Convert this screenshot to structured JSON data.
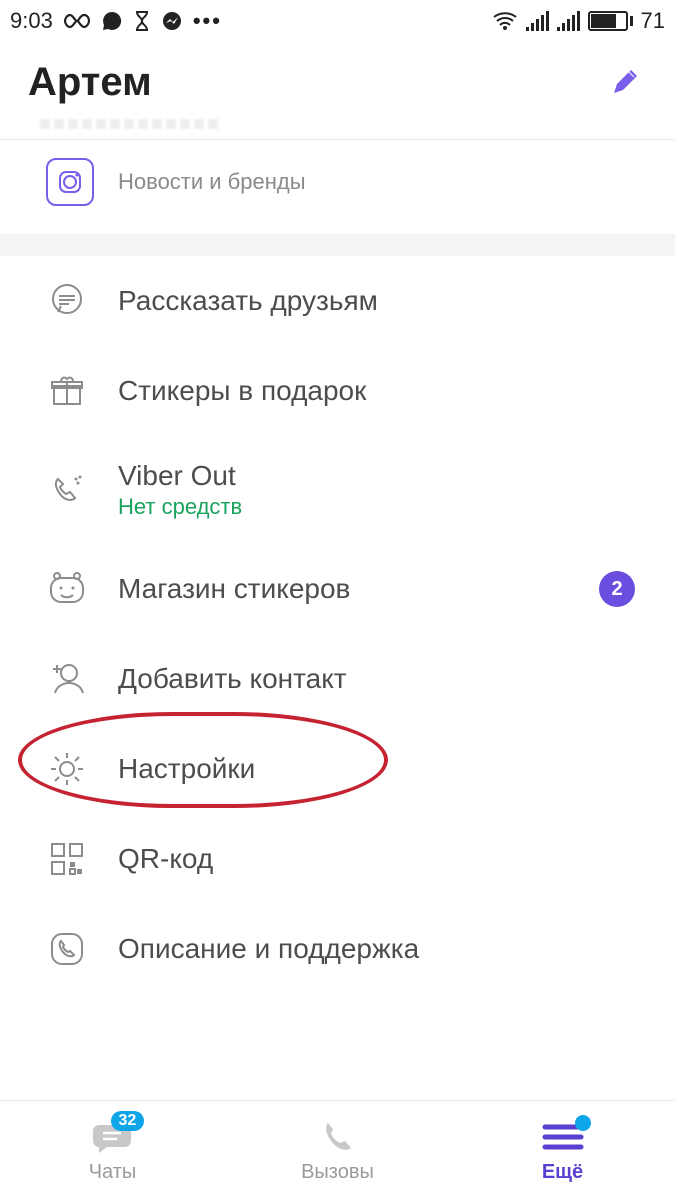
{
  "status": {
    "time": "9:03",
    "battery": "71"
  },
  "header": {
    "title": "Артем"
  },
  "news": {
    "subtitle": "Новости и бренды"
  },
  "menu": {
    "tell_friends": "Рассказать друзьям",
    "gift_stickers": "Стикеры в подарок",
    "viber_out": "Viber Out",
    "viber_out_sub": "Нет средств",
    "sticker_market": "Магазин стикеров",
    "sticker_badge": "2",
    "add_contact": "Добавить контакт",
    "settings": "Настройки",
    "qr": "QR-код",
    "support": "Описание и поддержка"
  },
  "nav": {
    "chats": "Чаты",
    "chats_badge": "32",
    "calls": "Вызовы",
    "more": "Ещё"
  }
}
